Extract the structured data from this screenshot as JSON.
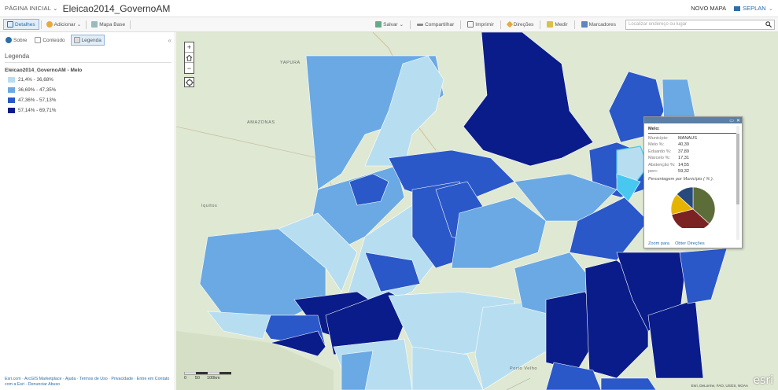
{
  "header": {
    "home_label": "PÁGINA INICIAL",
    "home_caret": "⌄",
    "map_title": "Eleicao2014_GovernoAM",
    "new_map": "NOVO MAPA",
    "org_name": "SEPLAN",
    "org_caret": "⌄"
  },
  "toolbar": {
    "details": "Detalhes",
    "add": "Adicionar",
    "add_caret": "⌄",
    "basemap": "Mapa Base",
    "save": "Salvar",
    "save_caret": "⌄",
    "share": "Compartilhar",
    "print": "Imprimir",
    "directions": "Direções",
    "measure": "Medir",
    "bookmarks": "Marcadores",
    "search_placeholder": "Localizar endereço ou lugar"
  },
  "sidebar": {
    "tabs": [
      {
        "label": "Sobre",
        "icon": "info-icon"
      },
      {
        "label": "Conteúdo",
        "icon": "content-icon"
      },
      {
        "label": "Legenda",
        "icon": "legend-icon"
      }
    ],
    "collapse": "«",
    "legend_heading": "Legenda",
    "layer_title": "Eleicao2014_GovernoAM - Melo",
    "classes": [
      {
        "label": "21,4% - 36,68%",
        "color": "#b7def0"
      },
      {
        "label": "36,69% - 47,35%",
        "color": "#6aa9e3"
      },
      {
        "label": "47,36% - 57,13%",
        "color": "#2a58c8"
      },
      {
        "label": "57,14% - 69,71%",
        "color": "#0a1c8a"
      }
    ],
    "footer_links": [
      "Esri.com",
      "ArcGIS Marketplace",
      "Ajuda",
      "Termos de Uso",
      "Privacidade",
      "Entre em Contato com a Esri",
      "Denunciar Abuso"
    ]
  },
  "map": {
    "zoom_in": "+",
    "zoom_out": "−",
    "labels": [
      {
        "text": "AMAZONAS"
      },
      {
        "text": "YAPURA"
      },
      {
        "text": "Iquitos"
      },
      {
        "text": "Porto Velho"
      }
    ],
    "scale_label": "0       50      100km",
    "attribution": "Esri, DeLorme, FAO, USGS, NOAA",
    "logo": "esri"
  },
  "popup": {
    "title": "Melo:",
    "fields": [
      {
        "key": "Município:",
        "value": "MANAUS"
      },
      {
        "key": "Melo %:",
        "value": "40,39"
      },
      {
        "key": "Eduardo %:",
        "value": "37,89"
      },
      {
        "key": "Marcelo %:",
        "value": "17,31"
      },
      {
        "key": "Abstenção %:",
        "value": "14,55"
      },
      {
        "key": "perc:",
        "value": "59,32"
      }
    ],
    "chart_title": "Percentagem por Município ( % ).",
    "pie": [
      {
        "name": "Melo",
        "value": 40.39,
        "color": "#5d6d3a"
      },
      {
        "name": "Eduardo",
        "value": 37.89,
        "color": "#7b2222"
      },
      {
        "name": "Marcelo",
        "value": 17.31,
        "color": "#e5b400"
      },
      {
        "name": "Abstenção",
        "value": 14.55,
        "color": "#284a7a"
      }
    ],
    "zoom_to": "Zoom para",
    "get_directions": "Obter Direções"
  }
}
